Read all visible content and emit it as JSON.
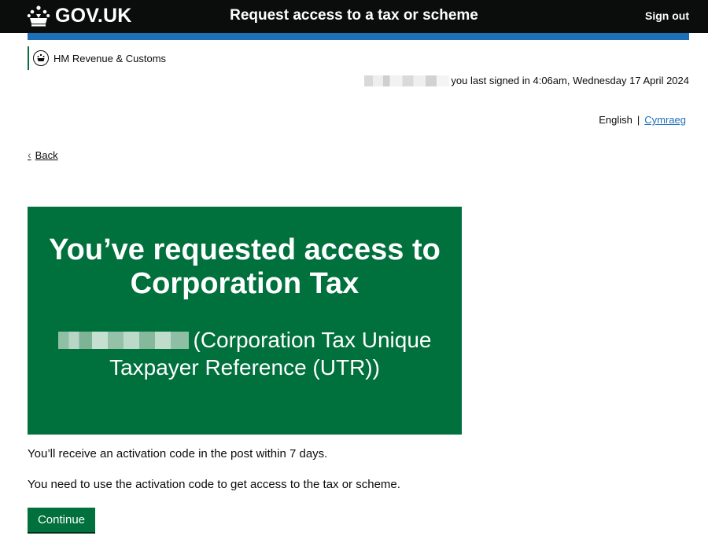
{
  "header": {
    "logo_text": "GOV.UK",
    "service_name": "Request access to a tax or scheme",
    "sign_out": "Sign out"
  },
  "organisation": {
    "name": "HM Revenue & Customs"
  },
  "session": {
    "last_signed_in": "you last signed in 4:06am, Wednesday 17 April 2024"
  },
  "language": {
    "current": "English",
    "separator": "|",
    "other": "Cymraeg"
  },
  "back_link": {
    "label": "Back"
  },
  "panel": {
    "title": "You’ve requested access to Corporation Tax",
    "reference_suffix": "(Corporation Tax Unique Taxpayer Reference (UTR))"
  },
  "content": {
    "paragraph_1": "You’ll receive an activation code in the post within 7 days.",
    "paragraph_2": "You need to use the activation code to get access to the tax or scheme."
  },
  "actions": {
    "continue": "Continue"
  },
  "colors": {
    "header_bg": "#0b0c0c",
    "brand_blue": "#1d70b8",
    "panel_green": "#00703c",
    "link": "#1d70b8"
  },
  "icons": {
    "logo": "crown-icon",
    "org": "crest-icon",
    "back": "chevron-left-icon"
  }
}
